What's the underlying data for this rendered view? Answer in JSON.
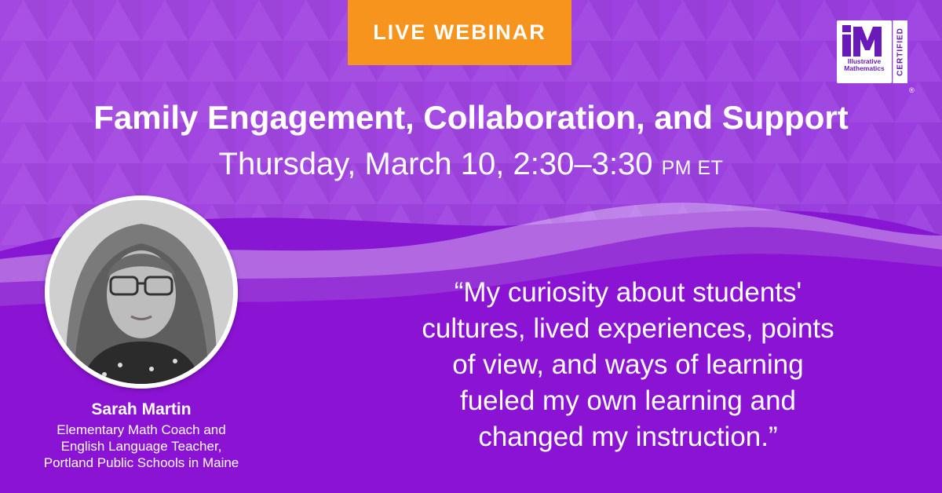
{
  "badge": {
    "label": "LIVE WEBINAR"
  },
  "event": {
    "title": "Family Engagement, Collaboration, and Support",
    "date_main": "Thursday, March 10, 2:30–3:30 ",
    "date_suffix": "PM ET"
  },
  "logo": {
    "mark": "iM",
    "line1": "Illustrative",
    "line2": "Mathematics",
    "certified": "CERTIFIED",
    "registered": "®"
  },
  "speaker": {
    "name": "Sarah Martin",
    "role_line1": "Elementary Math Coach and",
    "role_line2": "English Language Teacher,",
    "role_line3": "Portland Public Schools in Maine"
  },
  "quote": {
    "line1": "“My curiosity about students'",
    "line2": "cultures, lived experiences, points",
    "line3": "of view, and ways of learning",
    "line4": "fueled my own learning and",
    "line5": "changed my instruction.”"
  },
  "colors": {
    "background": "#8b1fd6",
    "badge": "#f7941d",
    "text": "#ffffff",
    "logo_accent": "#6a1ab8"
  }
}
